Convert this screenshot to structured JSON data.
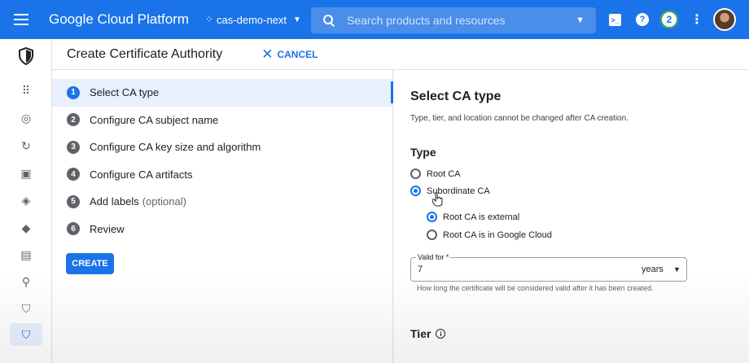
{
  "topbar": {
    "brand": "Google Cloud Platform",
    "project": "cas-demo-next",
    "search_placeholder": "Search products and resources",
    "notification_count": "2",
    "help_glyph": "?",
    "terminal_glyph": ">_",
    "colors": {
      "bar": "#1a73e8"
    }
  },
  "header": {
    "title": "Create Certificate Authority",
    "cancel_label": "CANCEL"
  },
  "steps": [
    {
      "num": "1",
      "label": "Select CA type",
      "optional": ""
    },
    {
      "num": "2",
      "label": "Configure CA subject name",
      "optional": ""
    },
    {
      "num": "3",
      "label": "Configure CA key size and algorithm",
      "optional": ""
    },
    {
      "num": "4",
      "label": "Configure CA artifacts",
      "optional": ""
    },
    {
      "num": "5",
      "label": "Add labels",
      "optional": "(optional)"
    },
    {
      "num": "6",
      "label": "Review",
      "optional": ""
    }
  ],
  "create_label": "CREATE",
  "panel": {
    "title": "Select CA type",
    "description": "Type, tier, and location cannot be changed after CA creation.",
    "type_heading": "Type",
    "type_options": [
      "Root CA",
      "Subordinate CA"
    ],
    "type_selected": "Subordinate CA",
    "root_options": [
      "Root CA is external",
      "Root CA is in Google Cloud"
    ],
    "root_selected": "Root CA is external",
    "valid_for": {
      "label": "Valid for *",
      "value": "7",
      "unit": "years"
    },
    "valid_hint": "How long the certificate will be considered valid after it has been created.",
    "tier_heading": "Tier"
  },
  "rail_icons": [
    "security-shield-icon",
    "dashboard-grid-icon",
    "target-icon",
    "refresh-icon",
    "chip-icon",
    "diamond-nodes-icon",
    "layers-icon",
    "certificate-icon",
    "key-search-icon",
    "shield-check-icon",
    "keyhole-shield-icon"
  ]
}
